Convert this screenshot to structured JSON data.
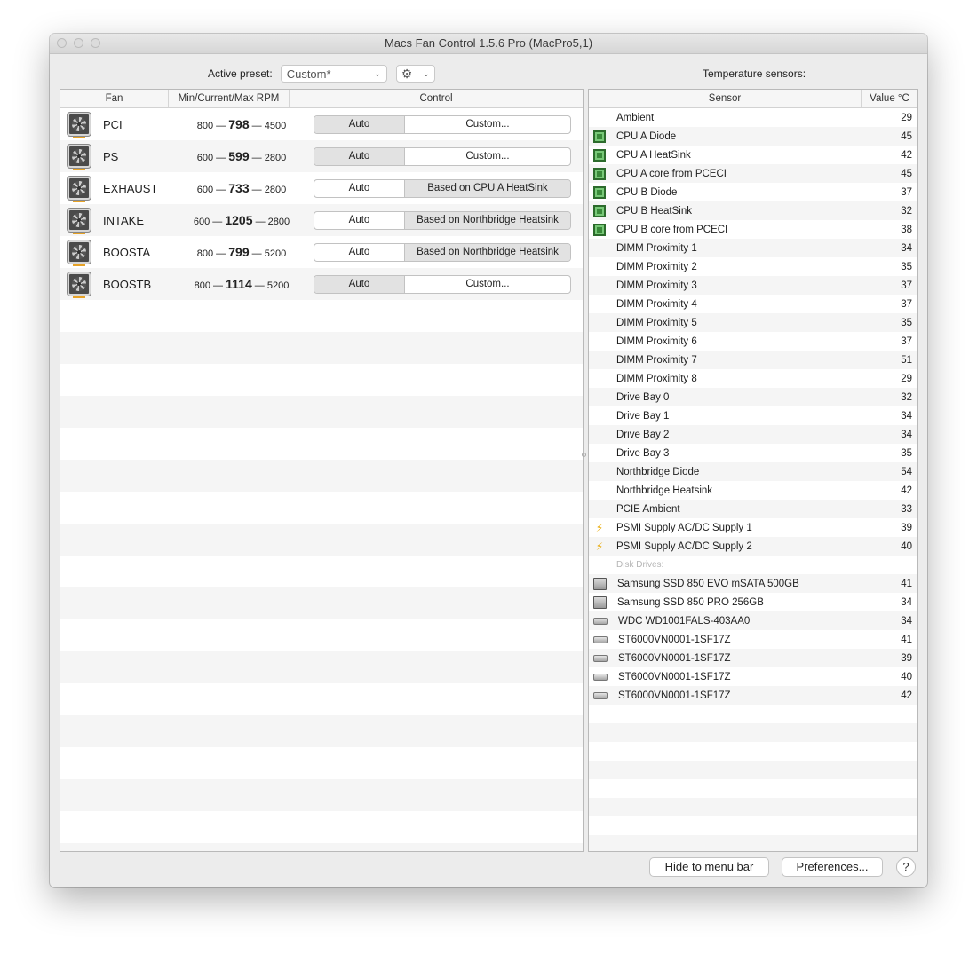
{
  "window": {
    "title": "Macs Fan Control 1.5.6 Pro (MacPro5,1)"
  },
  "preset": {
    "label": "Active preset:",
    "value": "Custom*"
  },
  "temps_heading": "Temperature sensors:",
  "fan_table": {
    "headers": [
      "Fan",
      "Min/Current/Max RPM",
      "Control"
    ],
    "rows": [
      {
        "name": "PCI",
        "min": "800",
        "current": "798",
        "max": "4500",
        "auto": "Auto",
        "custom": "Custom...",
        "mode": "custom"
      },
      {
        "name": "PS",
        "min": "600",
        "current": "599",
        "max": "2800",
        "auto": "Auto",
        "custom": "Custom...",
        "mode": "custom"
      },
      {
        "name": "EXHAUST",
        "min": "600",
        "current": "733",
        "max": "2800",
        "auto": "Auto",
        "custom": "Based on CPU A HeatSink",
        "mode": "custom"
      },
      {
        "name": "INTAKE",
        "min": "600",
        "current": "1205",
        "max": "2800",
        "auto": "Auto",
        "custom": "Based on Northbridge Heatsink",
        "mode": "custom"
      },
      {
        "name": "BOOSTA",
        "min": "800",
        "current": "799",
        "max": "5200",
        "auto": "Auto",
        "custom": "Based on Northbridge Heatsink",
        "mode": "custom"
      },
      {
        "name": "BOOSTB",
        "min": "800",
        "current": "1114",
        "max": "5200",
        "auto": "Auto",
        "custom": "Custom...",
        "mode": "custom"
      }
    ]
  },
  "sensor_table": {
    "headers": [
      "Sensor",
      "Value °C"
    ],
    "rows": [
      {
        "icon": "",
        "name": "Ambient",
        "value": "29"
      },
      {
        "icon": "cpu",
        "name": "CPU A Diode",
        "value": "45"
      },
      {
        "icon": "cpu",
        "name": "CPU A HeatSink",
        "value": "42"
      },
      {
        "icon": "cpu",
        "name": "CPU A core from PCECI",
        "value": "45"
      },
      {
        "icon": "cpu",
        "name": "CPU B Diode",
        "value": "37"
      },
      {
        "icon": "cpu",
        "name": "CPU B HeatSink",
        "value": "32"
      },
      {
        "icon": "cpu",
        "name": "CPU B core from PCECI",
        "value": "38"
      },
      {
        "icon": "",
        "name": "DIMM Proximity 1",
        "value": "34"
      },
      {
        "icon": "",
        "name": "DIMM Proximity 2",
        "value": "35"
      },
      {
        "icon": "",
        "name": "DIMM Proximity 3",
        "value": "37"
      },
      {
        "icon": "",
        "name": "DIMM Proximity 4",
        "value": "37"
      },
      {
        "icon": "",
        "name": "DIMM Proximity 5",
        "value": "35"
      },
      {
        "icon": "",
        "name": "DIMM Proximity 6",
        "value": "37"
      },
      {
        "icon": "",
        "name": "DIMM Proximity 7",
        "value": "51"
      },
      {
        "icon": "",
        "name": "DIMM Proximity 8",
        "value": "29"
      },
      {
        "icon": "",
        "name": "Drive Bay 0",
        "value": "32"
      },
      {
        "icon": "",
        "name": "Drive Bay 1",
        "value": "34"
      },
      {
        "icon": "",
        "name": "Drive Bay 2",
        "value": "34"
      },
      {
        "icon": "",
        "name": "Drive Bay 3",
        "value": "35"
      },
      {
        "icon": "",
        "name": "Northbridge Diode",
        "value": "54"
      },
      {
        "icon": "",
        "name": "Northbridge Heatsink",
        "value": "42"
      },
      {
        "icon": "",
        "name": "PCIE Ambient",
        "value": "33"
      },
      {
        "icon": "bolt",
        "name": "PSMI Supply AC/DC Supply 1",
        "value": "39"
      },
      {
        "icon": "bolt",
        "name": "PSMI Supply AC/DC Supply 2",
        "value": "40"
      },
      {
        "icon": "",
        "name": "Disk Drives:",
        "value": "",
        "group": true
      },
      {
        "icon": "ssd",
        "name": "Samsung SSD 850 EVO mSATA 500GB",
        "value": "41"
      },
      {
        "icon": "ssd",
        "name": "Samsung SSD 850 PRO 256GB",
        "value": "34"
      },
      {
        "icon": "hdd",
        "name": "WDC WD1001FALS-403AA0",
        "value": "34"
      },
      {
        "icon": "hdd",
        "name": "ST6000VN0001-1SF17Z",
        "value": "41"
      },
      {
        "icon": "hdd",
        "name": "ST6000VN0001-1SF17Z",
        "value": "39"
      },
      {
        "icon": "hdd",
        "name": "ST6000VN0001-1SF17Z",
        "value": "40"
      },
      {
        "icon": "hdd",
        "name": "ST6000VN0001-1SF17Z",
        "value": "42"
      }
    ]
  },
  "buttons": {
    "hide": "Hide to menu bar",
    "prefs": "Preferences...",
    "help": "?"
  }
}
